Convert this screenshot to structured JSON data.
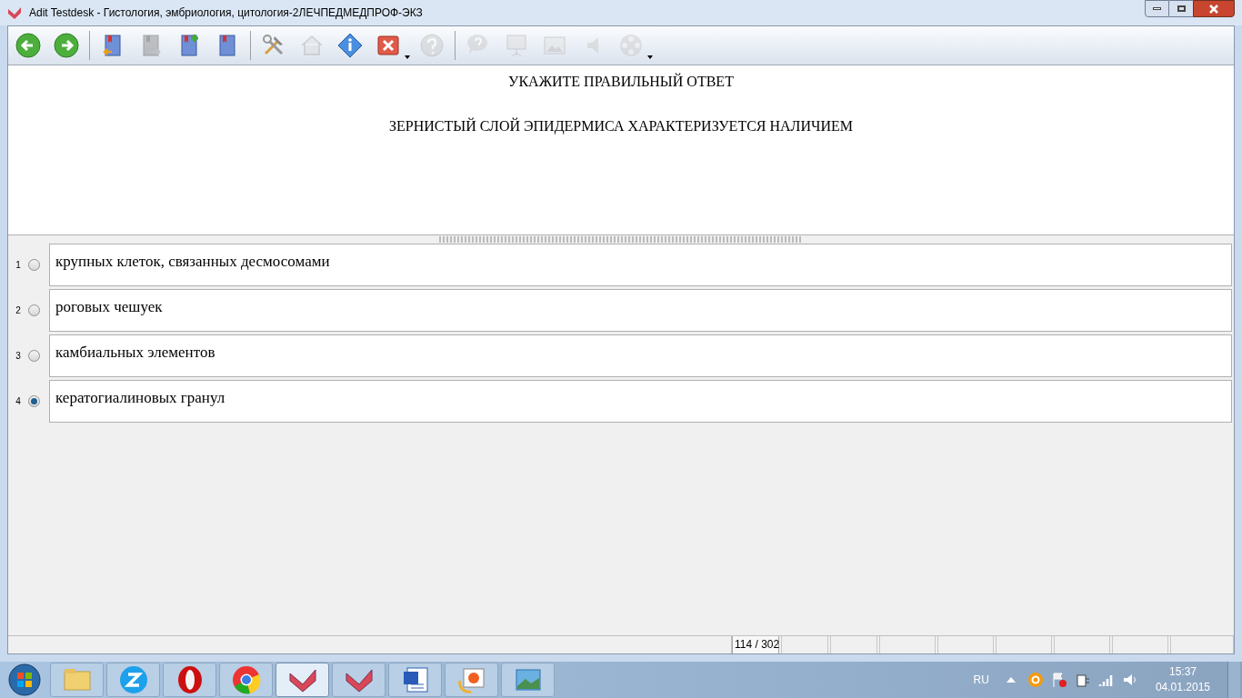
{
  "window": {
    "title": "Adit Testdesk - Гистология, эмбриология, цитология-2ЛЕЧПЕДМЕДПРОФ-ЭКЗ"
  },
  "toolbar": [
    {
      "kind": "back",
      "disabled": false,
      "dropdown": false
    },
    {
      "kind": "forward",
      "disabled": false,
      "dropdown": false
    },
    {
      "kind": "sep"
    },
    {
      "kind": "book-in",
      "disabled": false,
      "dropdown": false
    },
    {
      "kind": "book-out",
      "disabled": true,
      "dropdown": false
    },
    {
      "kind": "book-add",
      "disabled": false,
      "dropdown": false
    },
    {
      "kind": "book",
      "disabled": false,
      "dropdown": false
    },
    {
      "kind": "sep"
    },
    {
      "kind": "tools",
      "disabled": false,
      "dropdown": false
    },
    {
      "kind": "home",
      "disabled": true,
      "dropdown": false
    },
    {
      "kind": "info",
      "disabled": false,
      "dropdown": false
    },
    {
      "kind": "close",
      "disabled": false,
      "dropdown": true
    },
    {
      "kind": "help",
      "disabled": true,
      "dropdown": false
    },
    {
      "kind": "sep"
    },
    {
      "kind": "hint",
      "disabled": true,
      "dropdown": false
    },
    {
      "kind": "slide",
      "disabled": true,
      "dropdown": false
    },
    {
      "kind": "image",
      "disabled": true,
      "dropdown": false
    },
    {
      "kind": "sound",
      "disabled": true,
      "dropdown": false
    },
    {
      "kind": "video",
      "disabled": true,
      "dropdown": true
    }
  ],
  "question": {
    "instruction": "УКАЖИТЕ ПРАВИЛЬНЫЙ ОТВЕТ",
    "text": "ЗЕРНИСТЫЙ СЛОЙ ЭПИДЕРМИСА ХАРАКТЕРИЗУЕТСЯ НАЛИЧИЕМ"
  },
  "answers": [
    {
      "number": "1",
      "text": "крупных клеток, связанных десмосомами",
      "selected": false
    },
    {
      "number": "2",
      "text": "роговых чешуек",
      "selected": false
    },
    {
      "number": "3",
      "text": "камбиальных элементов",
      "selected": false
    },
    {
      "number": "4",
      "text": "кератогиалиновых гранул",
      "selected": true
    }
  ],
  "status_bar": {
    "counter": "114 / 302"
  },
  "taskbar": {
    "apps": [
      {
        "kind": "folder",
        "selected": false
      },
      {
        "kind": "zapp",
        "selected": false
      },
      {
        "kind": "opera",
        "selected": false
      },
      {
        "kind": "chrome",
        "selected": false
      },
      {
        "kind": "testdesk",
        "selected": true
      },
      {
        "kind": "testdesk",
        "selected": false
      },
      {
        "kind": "word",
        "selected": false
      },
      {
        "kind": "paint",
        "selected": false
      },
      {
        "kind": "photos",
        "selected": false
      }
    ],
    "language": "RU",
    "time": "15:37",
    "date": "04.01.2015"
  }
}
